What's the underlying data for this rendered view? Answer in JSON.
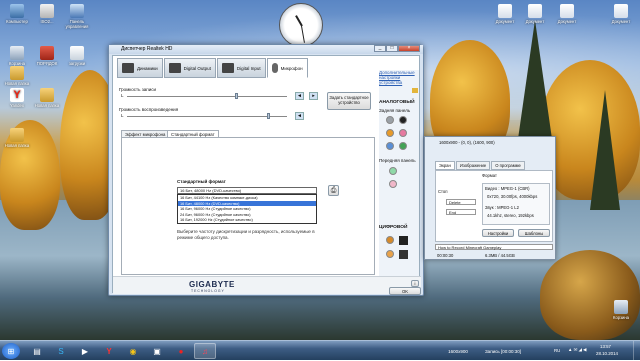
{
  "desktop": {
    "icons": [
      {
        "label": "Компьютер"
      },
      {
        "label": "ISO2..."
      },
      {
        "label": "Панель управления"
      },
      {
        "label": "Корзина"
      },
      {
        "label": "ПОРЯДОК"
      },
      {
        "label": "загрузки"
      },
      {
        "label": "Новая папка"
      },
      {
        "label": "Yandex"
      },
      {
        "label": "Новая папка"
      },
      {
        "label": "Новая папка"
      }
    ],
    "right_icons": [
      {
        "label": "Документ"
      },
      {
        "label": "Документ"
      },
      {
        "label": "Документ"
      },
      {
        "label": "Документ"
      },
      {
        "label": "Корзина"
      }
    ]
  },
  "realtek": {
    "title": "Диспетчер Realtek HD",
    "tabs": [
      "Динамики",
      "Digital Output",
      "Digital Input",
      "Микрофон"
    ],
    "record_volume_label": "Громкость записи",
    "playback_volume_label": "Громкость воспроизведения",
    "set_default_label": "Задать стандартное устройство",
    "side_link": "Дополнительные настройки устройства",
    "analog_label": "АНАЛОГОВЫЙ",
    "rear_panel": "Задняя панель",
    "front_panel": "Передняя панель",
    "digital_label": "ЦИФРОВОЙ",
    "subtabs": [
      "Эффект микрофона",
      "Стандартный формат"
    ],
    "format_heading": "Стандартный формат",
    "selected_format": "16 Бит, 48000 Hz (DVD-качество)",
    "options": [
      "16 Бит, 44100 Hz (Качество компакт-диска)",
      "16 Бит, 48000 Hz (DVD-качество)",
      "16 Бит, 96000 Hz (Студийное качество)",
      "24 Бит, 96000 Hz (Студийное качество)",
      "16 Бит, 192000 Hz (Студийное качество)"
    ],
    "hint": "Выберите частоту дискретизации и разрядность, используемые в режиме общего доступа.",
    "brand": "GIGABYTE",
    "brand_sub": "TECHNOLOGY",
    "ok": "OK",
    "info_icon": "i"
  },
  "capture": {
    "title": "1600x900 - (0, 0), (1600, 900)",
    "tabs": [
      "Экран",
      "Изображение",
      "О программе"
    ],
    "format_label": "Формат",
    "video_label": "Видео : MPEG-1 (CBR)",
    "video_info": "0x720, 30.00fps, 4000kbps",
    "audio_label": "Звук : MPEG-1 L2",
    "audio_info": "44.1khz, stereo, 192kbps",
    "stop_label": "Стоп",
    "delete_label": "Delete",
    "end_label": "End",
    "settings_btn": "Настройки",
    "templates_btn": "Шаблоны",
    "file_name": "How to Record Minecraft Gameplay",
    "time": "00:00:30",
    "size": "6.3MB / 44.5GB"
  },
  "taskbar": {
    "rec_label": "Запись [00:00:30]",
    "res_label": "1600x900",
    "lang": "RU",
    "time": "13:57",
    "date": "28.10.2014"
  }
}
